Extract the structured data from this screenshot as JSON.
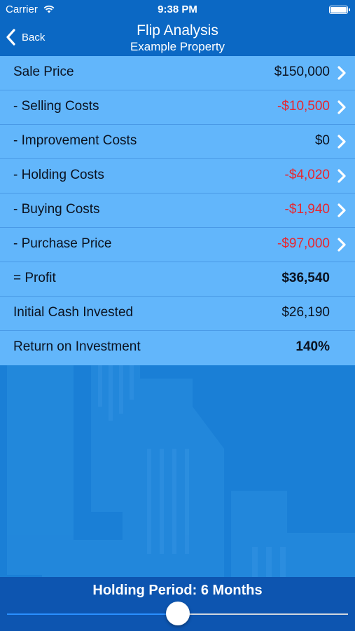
{
  "status": {
    "carrier": "Carrier",
    "time": "9:38 PM"
  },
  "nav": {
    "back_label": "Back",
    "title": "Flip Analysis",
    "subtitle": "Example Property"
  },
  "rows": [
    {
      "label": "Sale Price",
      "value": "$150,000",
      "negative": false,
      "bold": false,
      "chevron": true
    },
    {
      "label": "- Selling Costs",
      "value": "-$10,500",
      "negative": true,
      "bold": false,
      "chevron": true
    },
    {
      "label": "- Improvement Costs",
      "value": "$0",
      "negative": false,
      "bold": false,
      "chevron": true
    },
    {
      "label": "- Holding Costs",
      "value": "-$4,020",
      "negative": true,
      "bold": false,
      "chevron": true
    },
    {
      "label": "- Buying Costs",
      "value": "-$1,940",
      "negative": true,
      "bold": false,
      "chevron": true
    },
    {
      "label": "- Purchase Price",
      "value": "-$97,000",
      "negative": true,
      "bold": false,
      "chevron": true
    },
    {
      "label": "= Profit",
      "value": "$36,540",
      "negative": false,
      "bold": true,
      "chevron": false
    },
    {
      "label": "Initial Cash Invested",
      "value": "$26,190",
      "negative": false,
      "bold": false,
      "chevron": false
    },
    {
      "label": "Return on Investment",
      "value": "140%",
      "negative": false,
      "bold": true,
      "chevron": false
    }
  ],
  "holding": {
    "label": "Holding Period: 6 Months",
    "slider_fraction": 0.5
  },
  "colors": {
    "negative": "#e8262f",
    "accent": "#2a8fff",
    "nav": "#0b68c4",
    "bottom": "#0d55b0"
  }
}
